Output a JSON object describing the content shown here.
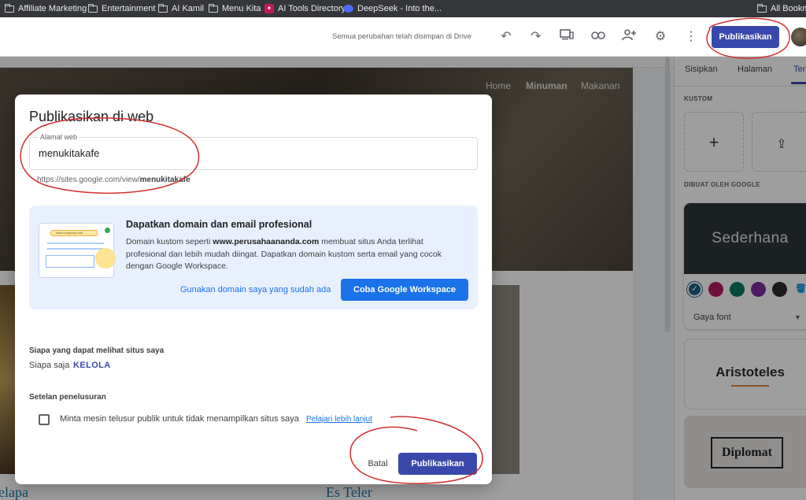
{
  "bookmarks": {
    "items": [
      {
        "label": "Affiliate Marketing",
        "icon": "folder-icon"
      },
      {
        "label": "Entertainment",
        "icon": "folder-icon"
      },
      {
        "label": "AI Kamil",
        "icon": "folder-icon"
      },
      {
        "label": "Menu Kita",
        "icon": "folder-icon"
      },
      {
        "label": "AI Tools Directory",
        "icon": "site-icon"
      },
      {
        "label": "DeepSeek - Into the...",
        "icon": "deepseek-icon"
      }
    ],
    "all_label": "All Bookmarks"
  },
  "toolbar": {
    "saved_status": "Semua perubahan telah disimpan di Drive",
    "icons": [
      "undo-icon",
      "redo-icon",
      "preview-icon",
      "link-icon",
      "share-icon",
      "settings-icon",
      "more-icon"
    ],
    "publish_label": "Publikasikan"
  },
  "canvas": {
    "nav": [
      "Home",
      "Minuman",
      "Makanan"
    ],
    "items": [
      "elapa",
      "Es Teler"
    ]
  },
  "panel": {
    "tabs": [
      "Sisipkan",
      "Halaman",
      "Ter"
    ],
    "custom_label": "KUSTOM",
    "google_label": "DIBUAT OLEH GOOGLE",
    "themes": {
      "sederhana": "Sederhana",
      "font_style": "Gaya font",
      "aristoteles": "Aristoteles",
      "diplomat": "Diplomat"
    },
    "swatch_colors": [
      "#1a5e8a",
      "#b01a5c",
      "#0b7a65",
      "#7b2c9e",
      "#2b2b2b"
    ]
  },
  "dialog": {
    "title": "Publikasikan di web",
    "address_label": "Alamat web",
    "address_value": "menukitakafe",
    "url_prefix": "https://sites.google.com/view/",
    "url_slug": "menukitakafe",
    "promo": {
      "title": "Dapatkan domain dan email profesional",
      "desc_prefix": "Domain kustom seperti ",
      "desc_domain": "www.perusahaananda.com",
      "desc_suffix": " membuat situs Anda terlihat profesional dan lebih mudah diingat. Dapatkan domain kustom serta email yang cocok dengan Google Workspace.",
      "link_label": "Gunakan domain saya yang sudah ada",
      "button_label": "Coba Google Workspace",
      "illus_bar_text": "www.company.com"
    },
    "visibility": {
      "title": "Siapa yang dapat melihat situs saya",
      "value": "Siapa saja",
      "manage_label": "KELOLA"
    },
    "search": {
      "title": "Setelan penelusuran",
      "checkbox_label": "Minta mesin telusur publik untuk tidak menampilkan situs saya",
      "checked": false,
      "learn_more": "Pelajari lebih lanjut"
    },
    "cancel_label": "Batal",
    "publish_label": "Publikasikan"
  },
  "colors": {
    "accent": "#3949ab",
    "link": "#1a73e8",
    "annotation": "#d32f2f"
  }
}
